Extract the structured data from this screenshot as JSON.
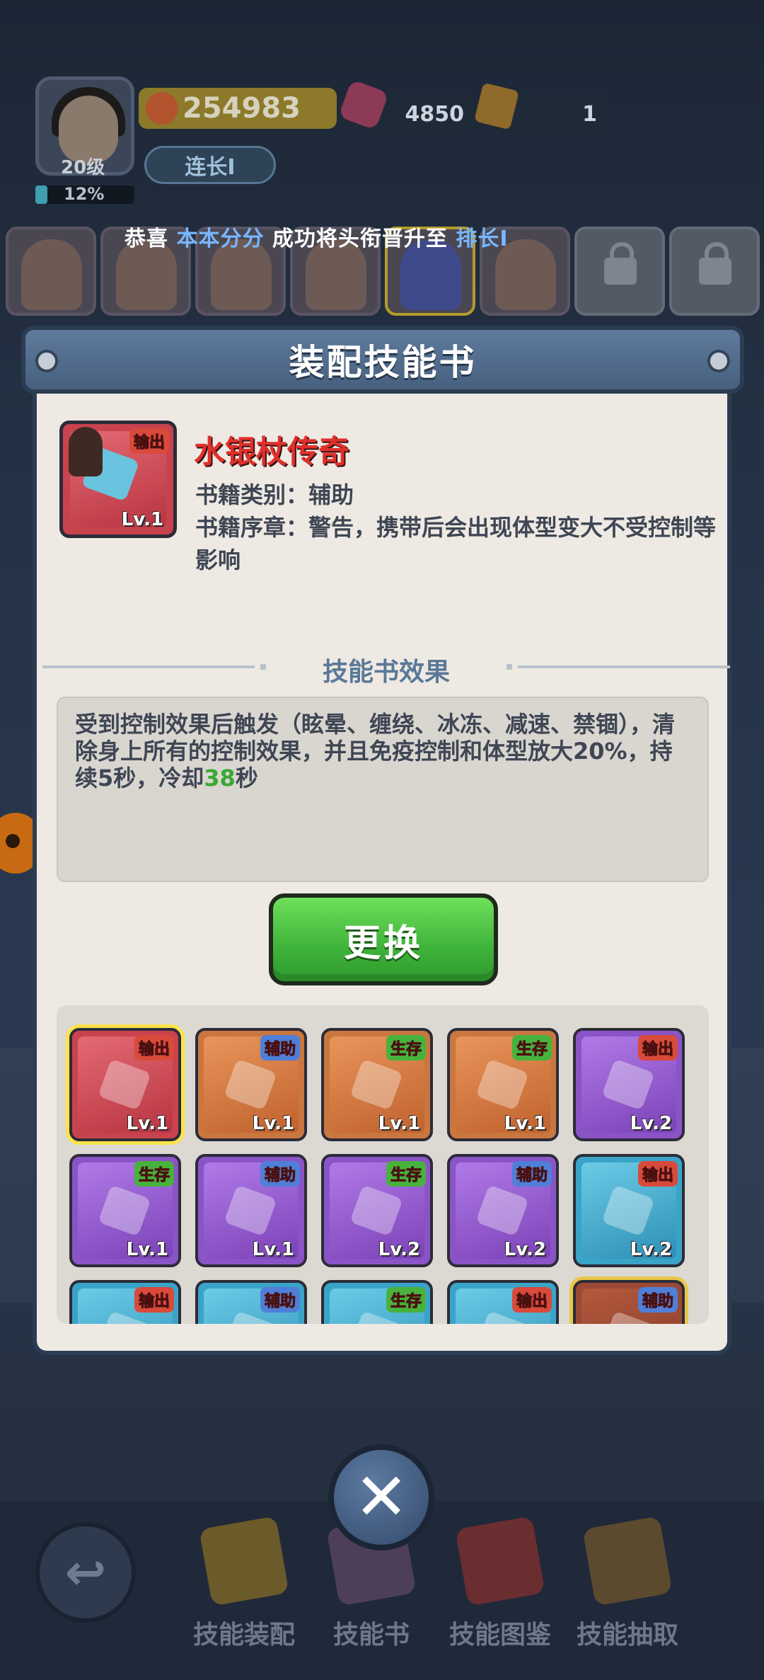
{
  "player": {
    "level_label": "20级",
    "exp_percent_label": "12%",
    "exp_fraction": 0.12,
    "power": "254983",
    "gems": "4850",
    "tickets": "1",
    "rank": "连长I"
  },
  "notice": {
    "prefix": "恭喜 ",
    "name": "本本分分",
    "middle": " 成功将头衔晋升至 ",
    "rank": "排长I"
  },
  "modal": {
    "title": "装配技能书",
    "book": {
      "name": "水银杖传奇",
      "tag": "输出",
      "level": "Lv.1",
      "category_line": "书籍类别：辅助",
      "preface_line": "书籍序章：警告，携带后会出现体型变大不受控制等影响"
    },
    "section_title": "技能书效果",
    "effect": {
      "text_before": "受到控制效果后触发（眩晕、缠绕、冰冻、减速、禁锢），清除身上所有的控制效果，并且免疫控制和体型放大20%，持续5秒，冷却",
      "number": "38",
      "text_after": "秒"
    },
    "swap_button": "更换",
    "cards": [
      {
        "tag": "输出",
        "level": "Lv.1",
        "color": "red"
      },
      {
        "tag": "辅助",
        "level": "Lv.1",
        "color": "orange"
      },
      {
        "tag": "生存",
        "level": "Lv.1",
        "color": "orange"
      },
      {
        "tag": "生存",
        "level": "Lv.1",
        "color": "orange"
      },
      {
        "tag": "输出",
        "level": "Lv.2",
        "color": "purple"
      },
      {
        "tag": "生存",
        "level": "Lv.1",
        "color": "purple"
      },
      {
        "tag": "辅助",
        "level": "Lv.1",
        "color": "purple"
      },
      {
        "tag": "生存",
        "level": "Lv.2",
        "color": "purple"
      },
      {
        "tag": "辅助",
        "level": "Lv.2",
        "color": "purple"
      },
      {
        "tag": "输出",
        "level": "Lv.2",
        "color": "blue"
      },
      {
        "tag": "输出",
        "level": "",
        "color": "blue"
      },
      {
        "tag": "辅助",
        "level": "",
        "color": "blue"
      },
      {
        "tag": "生存",
        "level": "",
        "color": "blue"
      },
      {
        "tag": "输出",
        "level": "",
        "color": "blue"
      },
      {
        "tag": "辅助",
        "level": "",
        "color": "gold"
      }
    ]
  },
  "nav": {
    "back_icon": "back-arrow-icon",
    "close_icon": "close-x-icon",
    "items": [
      {
        "label": "技能装配",
        "icon": "skill-equip-icon"
      },
      {
        "label": "技能书",
        "icon": "skill-book-icon"
      },
      {
        "label": "技能图鉴",
        "icon": "skill-gallery-icon"
      },
      {
        "label": "技能抽取",
        "icon": "skill-draw-icon"
      }
    ]
  },
  "colors": {
    "accent_name": "#e0302c",
    "highlight": "#79b6ff",
    "cooldown_number": "#3aa832",
    "button_green": "#3fb33a",
    "header_blue": "#5f7a9c"
  }
}
